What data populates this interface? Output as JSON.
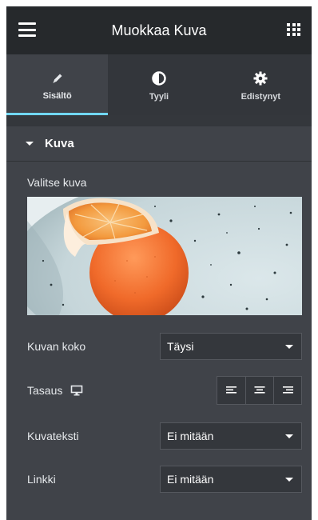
{
  "header": {
    "title": "Muokkaa Kuva"
  },
  "tabs": [
    {
      "label": "Sisältö",
      "icon": "pencil-icon",
      "active": true
    },
    {
      "label": "Tyyli",
      "icon": "half-circle-icon",
      "active": false
    },
    {
      "label": "Edistynyt",
      "icon": "gear-icon",
      "active": false
    }
  ],
  "section": {
    "title": "Kuva"
  },
  "fields": {
    "choose_image_label": "Valitse kuva",
    "image_size_label": "Kuvan koko",
    "image_size_value": "Täysi",
    "alignment_label": "Tasaus",
    "caption_label": "Kuvateksti",
    "caption_value": "Ei mitään",
    "link_label": "Linkki",
    "link_value": "Ei mitään"
  },
  "colors": {
    "header_bg": "#26292c",
    "panel_bg": "#404349",
    "tab_accent": "#71d7f7"
  }
}
